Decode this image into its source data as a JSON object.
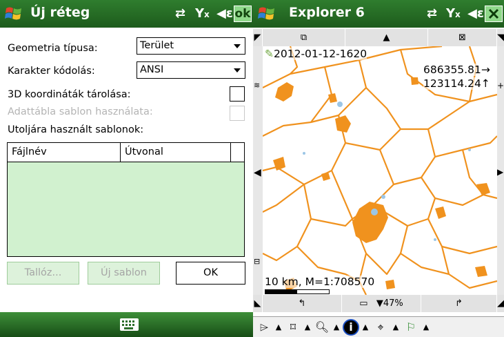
{
  "left": {
    "titlebar": {
      "title": "Új réteg",
      "ok_label": "ok"
    },
    "geometry": {
      "label": "Geometria típusa:",
      "value": "Terület"
    },
    "encoding": {
      "label": "Karakter kódolás:",
      "value": "ANSI"
    },
    "coords3d": {
      "label": "3D koordináták tárolása:"
    },
    "template_table": {
      "label": "Adattábla sablon használata:"
    },
    "recent": {
      "label": "Utoljára használt sablonok:"
    },
    "table": {
      "columns": [
        "Fájlnév",
        "Útvonal"
      ]
    },
    "buttons": {
      "browse": "Tallóz...",
      "new_template": "Új sablon",
      "ok": "OK"
    }
  },
  "right": {
    "titlebar": {
      "title": "Explorer 6"
    },
    "map": {
      "timestamp": "2012-01-12-1620",
      "coord_x": "686355.81",
      "coord_y": "123114.24",
      "scale": "10 km, M=1:708570",
      "zoom": "47%",
      "feature_color": "#f0921e",
      "water_color": "#9cc6e6"
    }
  }
}
